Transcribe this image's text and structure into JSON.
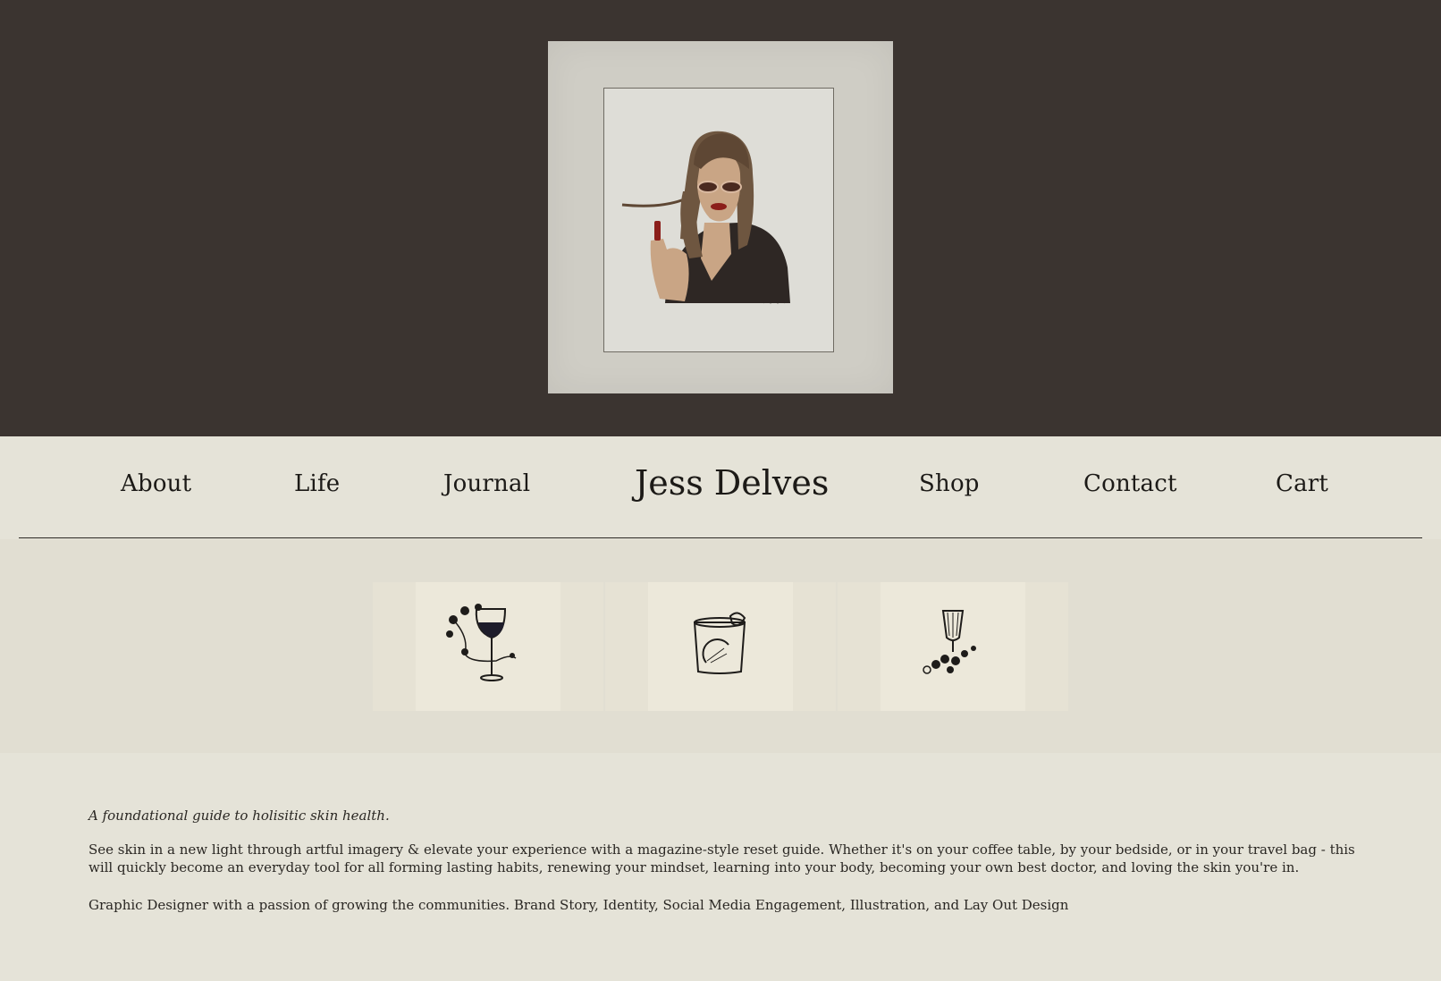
{
  "nav": {
    "about": "About",
    "life": "Life",
    "journal": "Journal",
    "brand": "Jess Delves",
    "shop": "Shop",
    "contact": "Contact",
    "cart": "Cart"
  },
  "hero": {
    "artwork_icon": "portrait-illustration-icon"
  },
  "gallery": {
    "items": [
      {
        "icon": "wine-glass-flowers-icon"
      },
      {
        "icon": "cocktail-lime-icon"
      },
      {
        "icon": "goblet-berries-icon"
      }
    ]
  },
  "content": {
    "tagline": "A foundational guide to holisitic skin health.",
    "paragraph": "See skin in a new light through artful imagery & elevate your experience with a magazine-style reset guide. Whether it's on your coffee table, by your bedside, or in your travel bag - this will quickly become an everyday tool for all forming lasting habits, renewing your mindset, learning into your body, becoming your own best doctor, and loving the skin you're in.",
    "bio": "Graphic Designer with a passion of growing the communities. Brand Story, Identity, Social Media Engagement, Illustration, and Lay Out Design"
  },
  "colors": {
    "hero_bg": "#3b3430",
    "page_bg": "#e5e3d8",
    "gallery_bg": "#e1ded2",
    "text": "#1c1a17"
  }
}
